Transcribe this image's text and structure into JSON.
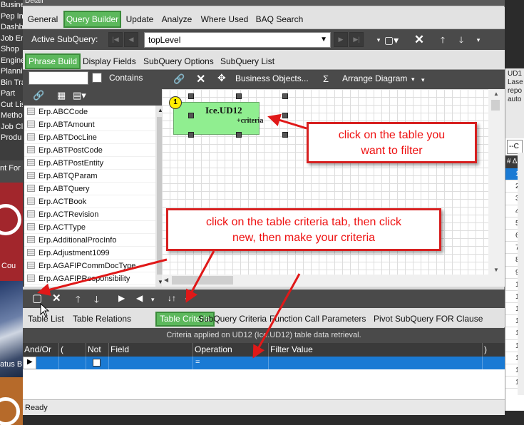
{
  "background": {
    "menu_items": [
      "Busine",
      "Pep In",
      "Dashb",
      "Job En",
      "Shop",
      "Engine",
      "Planni",
      "Bin Tra",
      "Part",
      "Cut Lis",
      "Metho",
      "Job Cl",
      "Produ"
    ],
    "label_frm": "nt For",
    "label_cou": "Cou",
    "label_status": "atus B"
  },
  "right_panel": {
    "text_lines": [
      "UD1",
      "Lase",
      "repo",
      "auto"
    ],
    "filter_value": "--C",
    "grid_header": "# Δ",
    "row_numbers": [
      "1",
      "2",
      "3",
      "4",
      "5",
      "6",
      "7",
      "8",
      "9",
      "10",
      "11",
      "12",
      "13",
      "14",
      "15",
      "16",
      "17",
      "18"
    ]
  },
  "window": {
    "title": "Detail",
    "main_tabs": [
      "General",
      "Query Builder",
      "Update",
      "Analyze",
      "Where Used",
      "BAQ Search"
    ],
    "active_main_tab": "Query Builder",
    "active_subquery_label": "Active SubQuery:",
    "subquery_value": "topLevel",
    "sub_tabs": [
      "Phrase Build",
      "Display Fields",
      "SubQuery Options",
      "SubQuery List"
    ]
  },
  "table_list": {
    "contains_label": "Contains",
    "items": [
      "Erp.ABCCode",
      "Erp.ABTAmount",
      "Erp.ABTDocLine",
      "Erp.ABTPostCode",
      "Erp.ABTPostEntity",
      "Erp.ABTQParam",
      "Erp.ABTQuery",
      "Erp.ACTBook",
      "Erp.ACTRevision",
      "Erp.ACTType",
      "Erp.AdditionalProcInfo",
      "Erp.Adjustment1099",
      "Erp.AGAFIPCommDocType",
      "Erp.AGAFIPResponsibility"
    ]
  },
  "diagram": {
    "toolbar": {
      "business_objects": "Business Objects...",
      "sigma": "Σ",
      "arrange": "Arrange Diagram"
    },
    "table_node": {
      "badge": "1",
      "name": "Ice.UD12",
      "criteria_marker": "+criteria"
    }
  },
  "bottom": {
    "tabs": [
      "Table List",
      "Table Relations",
      "Table Criteria",
      "SubQuery Criteria",
      "Function Call Parameters",
      "Pivot SubQuery FOR Clause"
    ],
    "active_tab": "Table Criteria",
    "caption": "Criteria applied on UD12 (Ice.UD12)  table data retrieval.",
    "columns": [
      "And/Or",
      "(",
      "Not",
      "Field",
      "Operation",
      "Filter Value",
      ")"
    ],
    "row": {
      "operation": "="
    }
  },
  "status": "Ready",
  "callouts": {
    "filter_line1": "click on the table you",
    "filter_line2": "want to filter",
    "criteria_line1": "click on the table criteria tab, then click",
    "criteria_line2": "new, then make your criteria"
  },
  "colors": {
    "accent_green": "#5cb85c",
    "selection_blue": "#1a7ad4",
    "callout_red": "#d72020",
    "node_green": "#90ee90"
  }
}
